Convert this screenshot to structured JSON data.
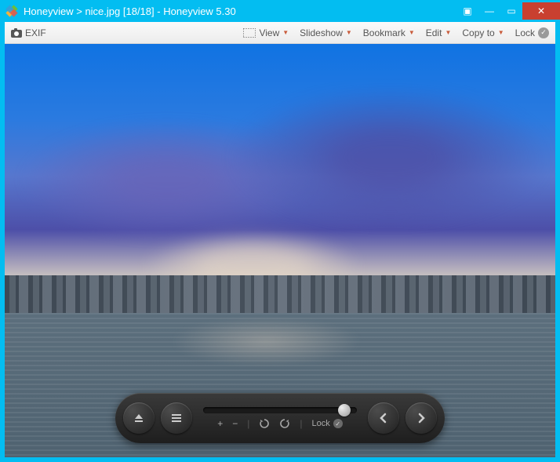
{
  "titlebar": {
    "app_name": "Honeyview",
    "separator": ">",
    "filename": "nice.jpg",
    "counter": "[18/18]",
    "dash": "-",
    "app_version": "Honeyview 5.30"
  },
  "toolbar": {
    "exif": "EXIF",
    "view": "View",
    "slideshow": "Slideshow",
    "bookmark": "Bookmark",
    "edit": "Edit",
    "copy_to": "Copy to",
    "lock": "Lock"
  },
  "floatbar": {
    "lock": "Lock",
    "plus": "+",
    "minus": "−"
  },
  "window_controls": {
    "minimize": "—",
    "maximize": "▭",
    "close": "✕",
    "extra": "▣"
  }
}
